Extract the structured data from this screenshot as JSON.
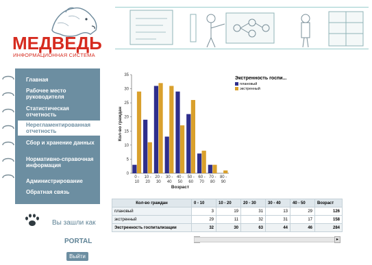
{
  "brand": {
    "name": "МЕДВЕДЬ",
    "subtitle": "ИНФОРМАЦИОННАЯ СИСТЕМА"
  },
  "sidebar": {
    "items": [
      {
        "label": "Главная"
      },
      {
        "label": "Рабочее место руководителя"
      },
      {
        "label": "Статистическая отчетность"
      },
      {
        "label": "Нерегламентированная отчетность",
        "active": true
      },
      {
        "label": "Сбор и хранение данных"
      },
      {
        "label": "Нормативно-справочная информация"
      },
      {
        "label": "Администрирование"
      },
      {
        "label": "Обратная связь"
      }
    ]
  },
  "login": {
    "text": "Вы зашли как",
    "user": "PORTAL",
    "logout_label": "Выйти"
  },
  "chart_data": {
    "type": "bar",
    "title": "Экстренность госпи...",
    "xlabel": "Возраст",
    "ylabel": "Кол-во граждан",
    "ylim": [
      0,
      35
    ],
    "yticks": [
      0,
      5,
      10,
      15,
      20,
      25,
      30,
      35
    ],
    "categories": [
      "0 - 10",
      "10 - 20",
      "20 - 30",
      "30 - 40",
      "40 - 50",
      "50 - 60",
      "60 - 70",
      "70 - 80",
      "80 - 90"
    ],
    "category_top": [
      "0 -",
      "10 -",
      "20 -",
      "30 -",
      "40 -",
      "50 -",
      "60 -",
      "70 -",
      "80 -"
    ],
    "category_bottom": [
      "10",
      "20",
      "30",
      "40",
      "50",
      "60",
      "70",
      "80",
      "90"
    ],
    "series": [
      {
        "name": "плановый",
        "color": "#2e2e8c",
        "values": [
          3,
          19,
          31,
          13,
          29,
          21,
          7,
          3,
          0
        ]
      },
      {
        "name": "экстренный",
        "color": "#d9a02c",
        "values": [
          29,
          11,
          32,
          31,
          17,
          26,
          8,
          3,
          1
        ]
      }
    ],
    "legend_position": "top-right"
  },
  "table": {
    "corner": "Кол-во граждан",
    "columns": [
      "0 - 10",
      "10 - 20",
      "20 - 30",
      "30 - 40",
      "40 - 50",
      "Возраст"
    ],
    "rows": [
      {
        "label": "плановый",
        "values": [
          "3",
          "19",
          "31",
          "13",
          "29",
          "126"
        ]
      },
      {
        "label": "экстренный",
        "values": [
          "29",
          "11",
          "32",
          "31",
          "17",
          "158"
        ]
      },
      {
        "label": "Экстренность госпитализации",
        "values": [
          "32",
          "30",
          "63",
          "44",
          "46",
          "284"
        ],
        "total": true
      }
    ]
  },
  "colors": {
    "sidebar_bg": "#6c8ea1",
    "brand_red": "#d62b1f",
    "series_planned": "#2e2e8c",
    "series_emergency": "#d9a02c"
  }
}
